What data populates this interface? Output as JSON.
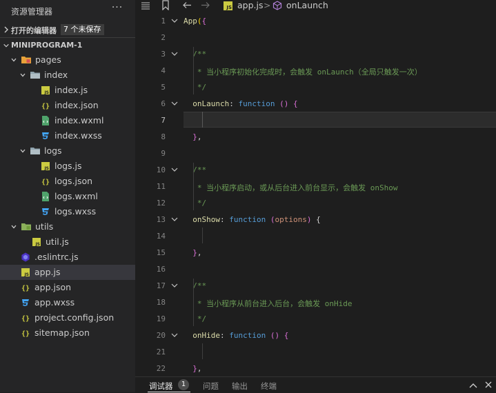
{
  "explorer": {
    "title": "资源管理器",
    "more": "···",
    "open_editors": {
      "label": "打开的编辑器",
      "badge": "7 个未保存"
    },
    "project": {
      "label": "MINIPROGRAM-1"
    },
    "tree": [
      {
        "label": "pages",
        "icon": "folder-pages-icon",
        "expanded": true
      },
      {
        "label": "index",
        "icon": "folder-icon",
        "expanded": true
      },
      {
        "label": "index.js",
        "icon": "js-file-icon"
      },
      {
        "label": "index.json",
        "icon": "json-file-icon"
      },
      {
        "label": "index.wxml",
        "icon": "wxml-file-icon"
      },
      {
        "label": "index.wxss",
        "icon": "css-file-icon"
      },
      {
        "label": "logs",
        "icon": "folder-icon",
        "expanded": true
      },
      {
        "label": "logs.js",
        "icon": "js-file-icon"
      },
      {
        "label": "logs.json",
        "icon": "json-file-icon"
      },
      {
        "label": "logs.wxml",
        "icon": "wxml-file-icon"
      },
      {
        "label": "logs.wxss",
        "icon": "css-file-icon"
      },
      {
        "label": "utils",
        "icon": "folder-utils-icon",
        "expanded": true
      },
      {
        "label": "util.js",
        "icon": "js-file-icon"
      },
      {
        "label": ".eslintrc.js",
        "icon": "eslint-file-icon"
      },
      {
        "label": "app.js",
        "icon": "js-file-icon",
        "selected": true
      },
      {
        "label": "app.json",
        "icon": "json-file-icon"
      },
      {
        "label": "app.wxss",
        "icon": "css-file-icon"
      },
      {
        "label": "project.config.json",
        "icon": "json-file-icon"
      },
      {
        "label": "sitemap.json",
        "icon": "json-file-icon"
      }
    ]
  },
  "breadcrumb": {
    "file": "app.js",
    "file_badge": "JS",
    "symbol": "onLaunch",
    "sep": ">"
  },
  "editor": {
    "current_line": 7,
    "lines": [
      {
        "n": "1",
        "text": "App({"
      },
      {
        "n": "2",
        "text": ""
      },
      {
        "n": "3",
        "text": "  /**"
      },
      {
        "n": "4",
        "text": "   * 当小程序初始化完成时，会触发 onLaunch（全局只触发一次）"
      },
      {
        "n": "5",
        "text": "   */"
      },
      {
        "n": "6",
        "text": "  onLaunch: function () {"
      },
      {
        "n": "7",
        "text": ""
      },
      {
        "n": "8",
        "text": "  },"
      },
      {
        "n": "9",
        "text": ""
      },
      {
        "n": "10",
        "text": "  /**"
      },
      {
        "n": "11",
        "text": "   * 当小程序启动，或从后台进入前台显示，会触发 onShow"
      },
      {
        "n": "12",
        "text": "   */"
      },
      {
        "n": "13",
        "text": "  onShow: function (options) {"
      },
      {
        "n": "14",
        "text": ""
      },
      {
        "n": "15",
        "text": "  },"
      },
      {
        "n": "16",
        "text": ""
      },
      {
        "n": "17",
        "text": "  /**"
      },
      {
        "n": "18",
        "text": "   * 当小程序从前台进入后台，会触发 onHide"
      },
      {
        "n": "19",
        "text": "   */"
      },
      {
        "n": "20",
        "text": "  onHide: function () {"
      },
      {
        "n": "21",
        "text": ""
      },
      {
        "n": "22",
        "text": "  },"
      }
    ]
  },
  "panel": {
    "tabs": [
      "调试器",
      "问题",
      "输出",
      "终端"
    ],
    "debug_count": "1"
  },
  "colors": {
    "keyword": "#569cd6",
    "function": "#dcdcaa",
    "property": "#9cdcfe",
    "comment": "#6a9955",
    "param": "#ce9178",
    "bracket": "#ffd700",
    "text": "#d4d4d4"
  }
}
